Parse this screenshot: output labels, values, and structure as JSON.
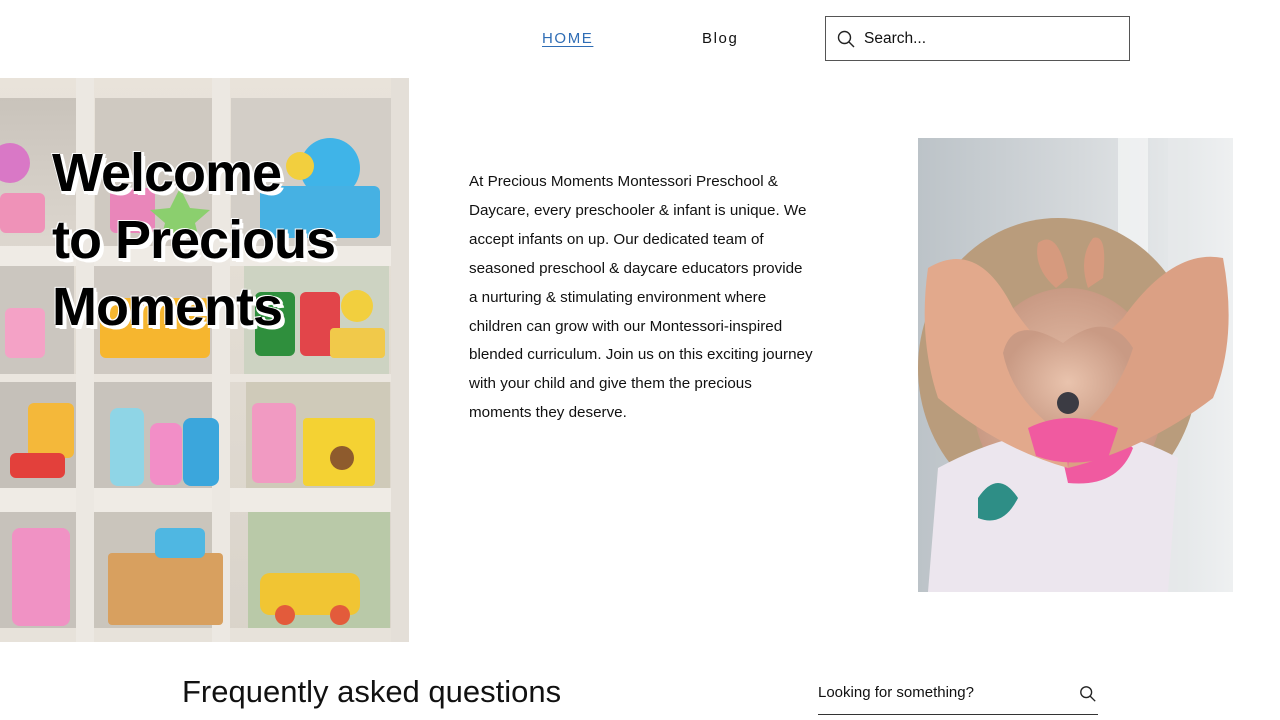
{
  "nav": {
    "items": [
      {
        "label": "HOME",
        "active": true
      },
      {
        "label": "Blog",
        "active": false
      }
    ],
    "search": {
      "placeholder": "Search...",
      "icon": "search-icon"
    }
  },
  "hero": {
    "title_lines": [
      "Welcome",
      "to Precious",
      "Moments"
    ],
    "image": "toy-shelf-illustration"
  },
  "intro": {
    "text": "At Precious Moments Montessori Preschool & Daycare, every preschooler & infant is unique. We accept infants on up. Our dedicated team of seasoned preschool & daycare educators provide a nurturing & stimulating environment where children can grow with our Montessori-inspired blended curriculum. Join us on this exciting journey with your child and give them the precious moments they deserve."
  },
  "photo": {
    "image": "child-heart-hands-photo"
  },
  "faq": {
    "title": "Frequently asked questions",
    "search_placeholder": "Looking for something?",
    "icon": "search-icon"
  },
  "colors": {
    "accent_link": "#2f6db5",
    "text": "#111111",
    "background": "#ffffff"
  }
}
